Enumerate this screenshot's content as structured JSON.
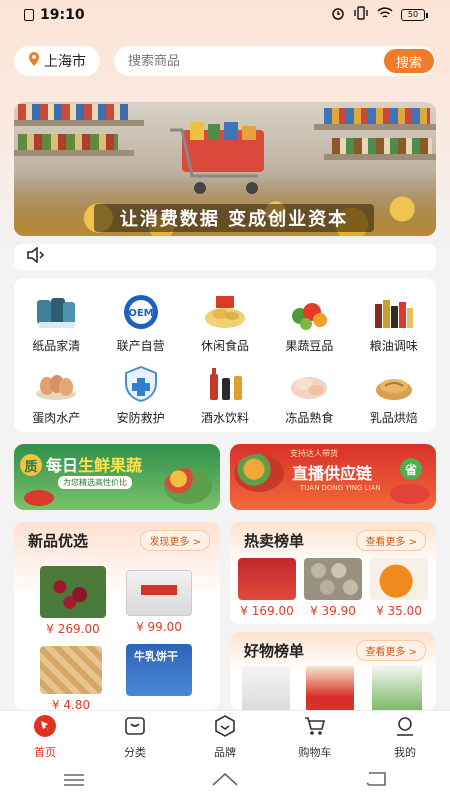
{
  "status_bar": {
    "time": "19:10",
    "battery": "50"
  },
  "search": {
    "city": "上海市",
    "placeholder": "搜索商品",
    "button": "搜索"
  },
  "banner": {
    "headline": "让消费数据 变成创业资本"
  },
  "categories": [
    {
      "label": "纸品家清",
      "icon": "paper-icon"
    },
    {
      "label": "联产自营",
      "icon": "oem-icon"
    },
    {
      "label": "休闲食品",
      "icon": "snack-icon"
    },
    {
      "label": "果蔬豆品",
      "icon": "vegetable-icon"
    },
    {
      "label": "粮油调味",
      "icon": "condiment-icon"
    },
    {
      "label": "蛋肉水产",
      "icon": "egg-icon"
    },
    {
      "label": "安防救护",
      "icon": "shield-icon"
    },
    {
      "label": "酒水饮料",
      "icon": "drink-icon"
    },
    {
      "label": "冻品熟食",
      "icon": "frozen-icon"
    },
    {
      "label": "乳品烘焙",
      "icon": "bread-icon"
    }
  ],
  "promos": {
    "left": {
      "badge": "质",
      "title_a": "每日",
      "title_b": "生鲜果蔬",
      "subtitle": "为您精选高性价比"
    },
    "right": {
      "tag": "支持达人带货",
      "title": "直播供应链",
      "badge": "省",
      "subtitle": "TUAN DONG YING LIAN"
    }
  },
  "new_products": {
    "title": "新品优选",
    "more": "发现更多 >",
    "items": [
      {
        "price": "¥ 269.00"
      },
      {
        "price": "¥ 99.00"
      },
      {
        "price": "¥ 4.80"
      },
      {
        "price": ""
      }
    ],
    "item_texts": [
      "牛乳饼干"
    ]
  },
  "hot_products": {
    "title": "热卖榜单",
    "more": "查看更多 >",
    "items": [
      {
        "price": "¥ 169.00"
      },
      {
        "price": "¥ 39.90"
      },
      {
        "price": "¥ 35.00"
      }
    ]
  },
  "good_products": {
    "title": "好物榜单",
    "more": "查看更多 >"
  },
  "tabs": [
    {
      "label": "首页",
      "icon": "home-icon",
      "active": true
    },
    {
      "label": "分类",
      "icon": "category-icon",
      "active": false
    },
    {
      "label": "品牌",
      "icon": "brand-icon",
      "active": false
    },
    {
      "label": "购物车",
      "icon": "cart-icon",
      "active": false
    },
    {
      "label": "我的",
      "icon": "profile-icon",
      "active": false
    }
  ],
  "colors": {
    "accent": "#f47a2a",
    "price": "#e33b25",
    "active_tab": "#e0321f"
  }
}
